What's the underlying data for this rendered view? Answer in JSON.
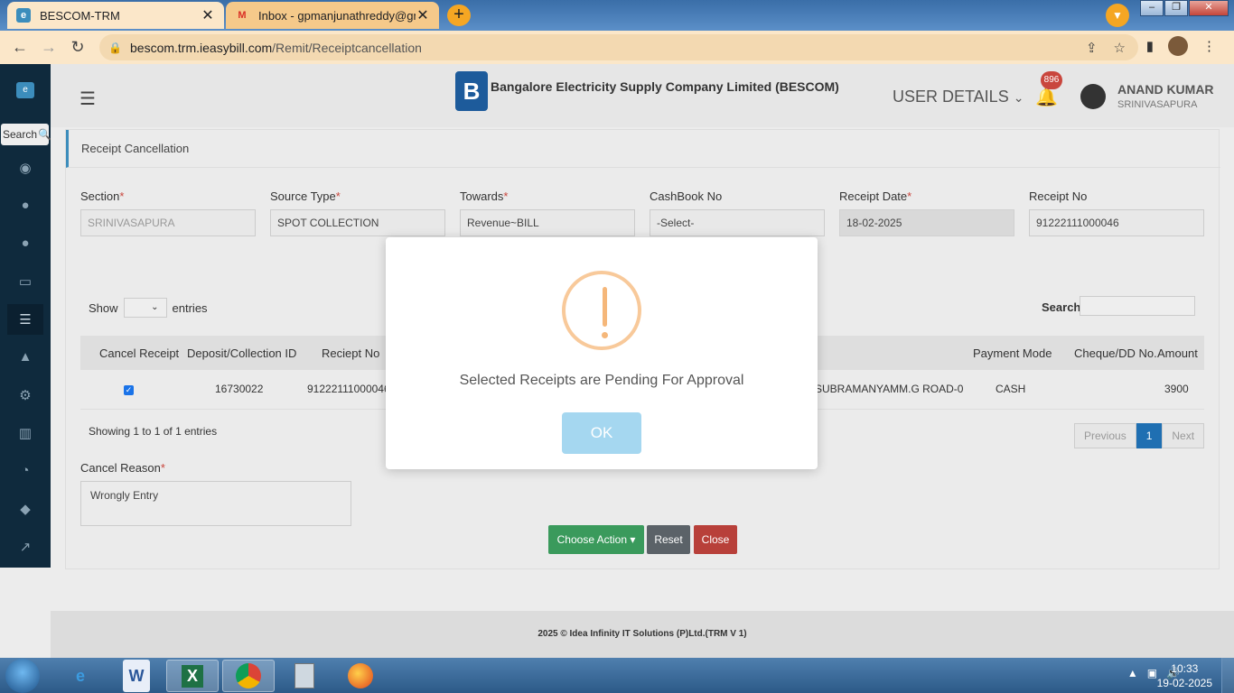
{
  "browser": {
    "tabs": [
      {
        "title": "BESCOM-TRM",
        "favicon": "bescom-favicon",
        "active": true
      },
      {
        "title": "Inbox - gpmanjunathreddy@gma",
        "favicon": "gmail-favicon",
        "active": false
      }
    ],
    "url_host": "bescom.trm.ieasybill.com",
    "url_path": "/Remit/Receiptcancellation"
  },
  "sidebar": {
    "search_label": "Search"
  },
  "header": {
    "company": "Bangalore Electricity Supply Company Limited (BESCOM)",
    "user_details_label": "USER DETAILS",
    "notification_count": "896",
    "user_name": "ANAND KUMAR",
    "user_location": "SRINIVASAPURA"
  },
  "page": {
    "title": "Receipt Cancellation",
    "fields": [
      {
        "label": "Section",
        "required": true,
        "value": "SRINIVASAPURA"
      },
      {
        "label": "Source Type",
        "required": true,
        "value": "SPOT COLLECTION"
      },
      {
        "label": "Towards",
        "required": true,
        "value": "Revenue~BILL"
      },
      {
        "label": "CashBook No",
        "required": false,
        "value": "-Select-"
      },
      {
        "label": "Receipt Date",
        "required": true,
        "value": "18-02-2025"
      },
      {
        "label": "Receipt No",
        "required": false,
        "value": "91222111000046"
      }
    ],
    "show_label": "Show",
    "entries_label": "entries",
    "search_label": "Search:",
    "table": {
      "headers": [
        "Cancel Receipt",
        "Deposit/Collection ID",
        "Reciept No",
        "Payment Mode",
        "Cheque/DD No.",
        "Amount"
      ],
      "rows": [
        {
          "deposit_id": "16730022",
          "receipt_no": "91222111000046",
          "address": "SUBRAMANYAMM.G ROAD-0",
          "payment_mode": "CASH",
          "cheque": "",
          "amount": "3900",
          "checked": true
        }
      ]
    },
    "showing_text": "Showing 1 to 1 of 1 entries",
    "pager": {
      "previous": "Previous",
      "current": "1",
      "next": "Next"
    },
    "cancel_reason_label": "Cancel Reason",
    "cancel_reason_value": "Wrongly Entry",
    "buttons": {
      "choose_action": "Choose Action",
      "reset": "Reset",
      "close": "Close"
    },
    "footer": "2025 © Idea Infinity IT Solutions (P)Ltd.(TRM V 1)"
  },
  "modal": {
    "message": "Selected Receipts are Pending For Approval",
    "ok_label": "OK",
    "icon": "warning-icon"
  },
  "taskbar": {
    "time": "10:33",
    "date": "19-02-2025"
  }
}
